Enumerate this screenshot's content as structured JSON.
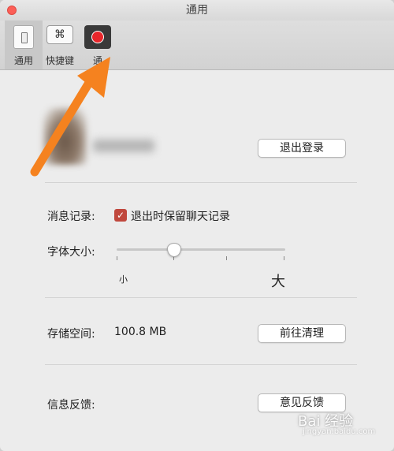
{
  "window": {
    "title": "通用"
  },
  "toolbar": {
    "tabs": [
      {
        "label": "通用",
        "icon": "switch-icon",
        "active": true
      },
      {
        "label": "快捷键",
        "icon": "command-key-icon",
        "active": false
      },
      {
        "label": "通",
        "icon": "record-icon",
        "active": false
      }
    ]
  },
  "account": {
    "logout_label": "退出登录"
  },
  "messages": {
    "label": "消息记录:",
    "checkbox_label": "退出时保留聊天记录",
    "checked": true
  },
  "font_size": {
    "label": "字体大小:",
    "small": "小",
    "large": "大",
    "level": 0.33
  },
  "storage": {
    "label": "存储空间:",
    "value": "100.8 MB",
    "clear_label": "前往清理"
  },
  "feedback": {
    "label": "信息反馈:",
    "button_label": "意见反馈"
  },
  "watermark": {
    "text": "Bai 经验",
    "subtext": "jingyan.baidu.com"
  },
  "colors": {
    "arrow": "#f5821f",
    "checkbox": "#c0483d",
    "close": "#fc5f57"
  }
}
